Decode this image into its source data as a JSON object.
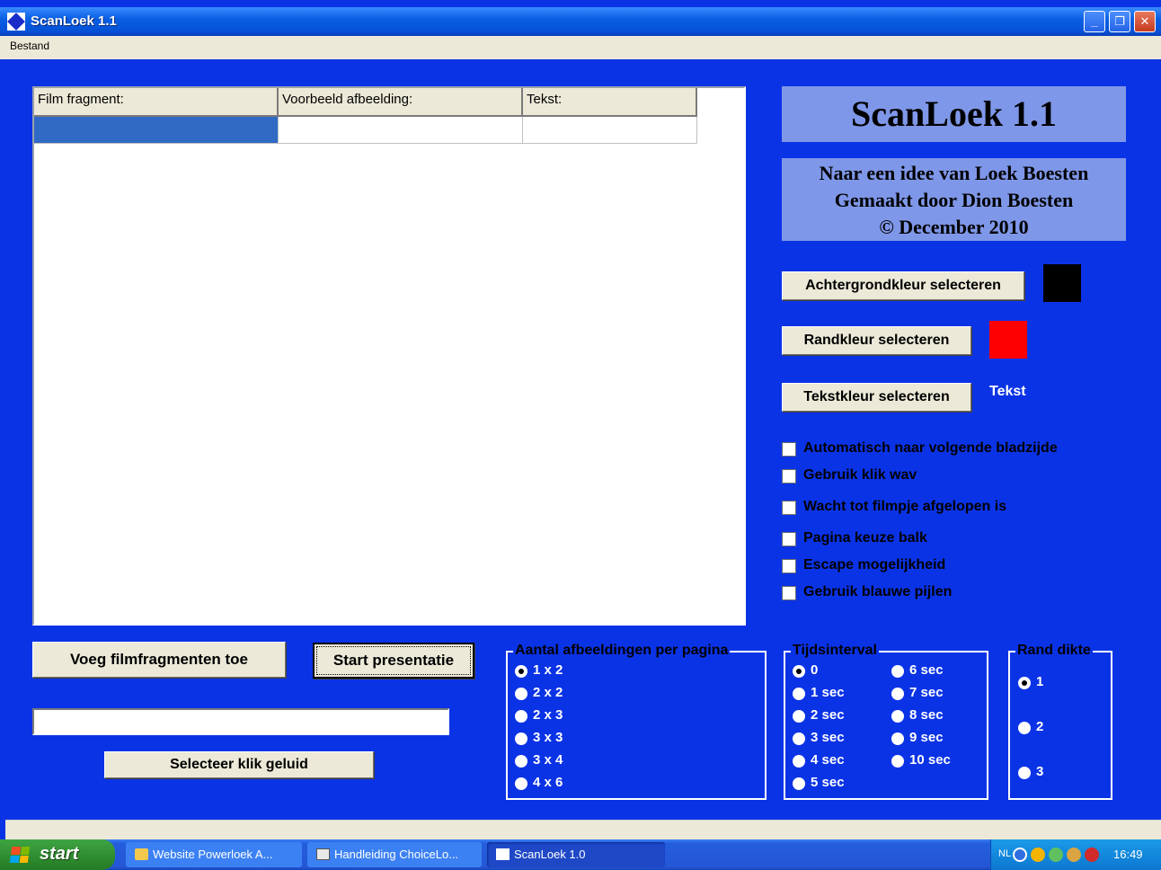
{
  "window": {
    "title": "ScanLoek 1.1",
    "controls": {
      "minimize": "_",
      "restore": "❐",
      "close": "✕"
    }
  },
  "menu": {
    "items": [
      "Bestand"
    ]
  },
  "grid": {
    "columns": [
      "Film fragment:",
      "Voorbeeld afbeelding:",
      "Tekst:"
    ],
    "rows": [
      [
        "",
        "",
        ""
      ]
    ]
  },
  "banner": {
    "title": "ScanLoek 1.1"
  },
  "credits": {
    "line1": "Naar een idee van Loek Boesten",
    "line2": "Gemaakt door Dion Boesten",
    "line3": "© December 2010"
  },
  "colors": {
    "background_button": "Achtergrondkleur selecteren",
    "background_swatch": "#000000",
    "border_button": "Randkleur selecteren",
    "border_swatch": "#ff0000",
    "text_button": "Tekstkleur selecteren",
    "text_preview": "Tekst",
    "text_preview_color": "#ffffff"
  },
  "options": [
    {
      "label": "Automatisch naar volgende bladzijde",
      "checked": false
    },
    {
      "label": "Gebruik klik wav",
      "checked": false
    },
    {
      "label": "Wacht tot filmpje afgelopen is",
      "checked": false
    },
    {
      "label": "Pagina keuze balk",
      "checked": false
    },
    {
      "label": "Escape mogelijkheid",
      "checked": false
    },
    {
      "label": "Gebruik blauwe pijlen",
      "checked": false
    }
  ],
  "actions": {
    "add_fragments": "Voeg filmfragmenten toe",
    "start": "Start presentatie",
    "select_click_sound": "Selecteer klik geluid",
    "click_sound_path": ""
  },
  "per_page": {
    "legend": "Aantal afbeeldingen per pagina",
    "options": [
      "1 x 2",
      "2 x 2",
      "2 x 3",
      "3 x 3",
      "3 x 4",
      "4 x 6"
    ],
    "selected": "1 x 2"
  },
  "interval": {
    "legend": "Tijdsinterval",
    "options": [
      "0",
      "1 sec",
      "2 sec",
      "3 sec",
      "4 sec",
      "5 sec",
      "6 sec",
      "7 sec",
      "8 sec",
      "9 sec",
      "10 sec"
    ],
    "selected": "0"
  },
  "border_width": {
    "legend": "Rand dikte",
    "options": [
      "1",
      "2",
      "3"
    ],
    "selected": "1"
  },
  "taskbar": {
    "start": "start",
    "tasks": [
      {
        "label": "Website Powerloek A...",
        "active": false
      },
      {
        "label": "Handleiding ChoiceLo...",
        "active": false
      },
      {
        "label": "ScanLoek 1.0",
        "active": true
      }
    ],
    "lang": "NL",
    "clock": "16:49"
  }
}
